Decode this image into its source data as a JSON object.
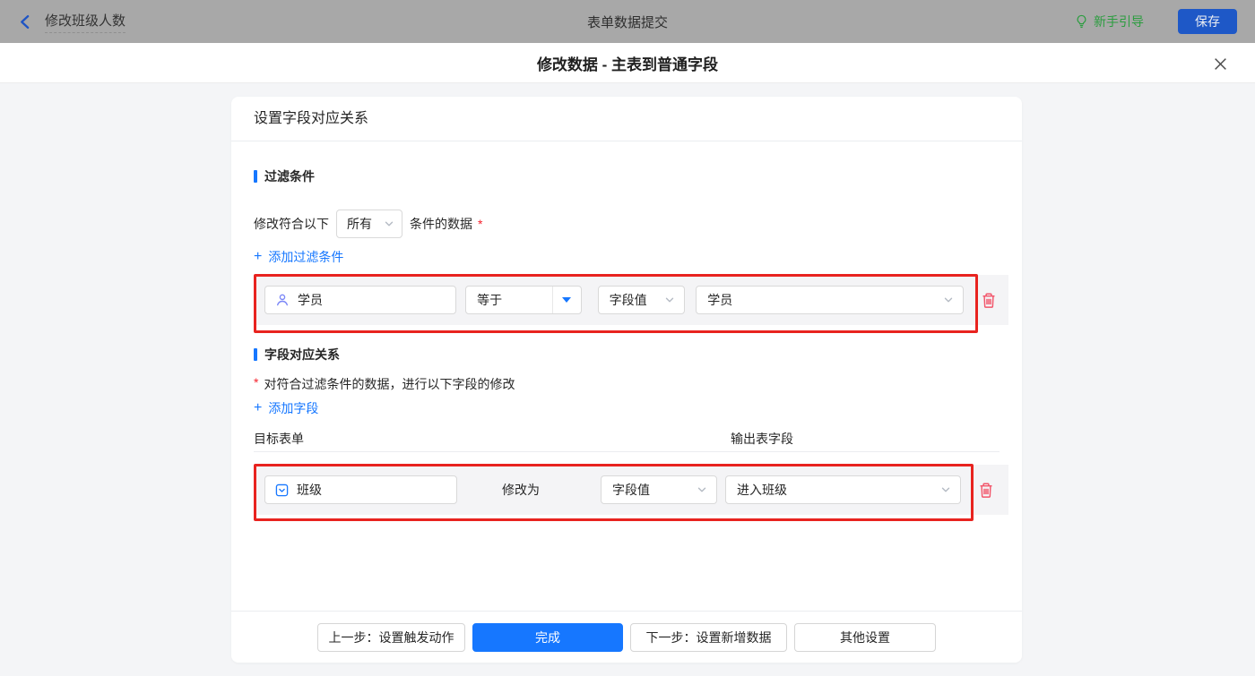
{
  "topbar": {
    "back_title": "修改班级人数",
    "center_title": "表单数据提交",
    "guide_label": "新手引导",
    "save_label": "保存"
  },
  "dialog": {
    "title": "修改数据 - 主表到普通字段"
  },
  "card": {
    "header": "设置字段对应关系",
    "filter_section": {
      "title": "过滤条件",
      "sentence_prefix": "修改符合以下",
      "match_select_value": "所有",
      "sentence_suffix": "条件的数据",
      "required_mark": "*",
      "add_plus": "+",
      "add_label": "添加过滤条件",
      "row": {
        "field": "学员",
        "operator": "等于",
        "value_type": "字段值",
        "value": "学员"
      }
    },
    "mapping_section": {
      "title": "字段对应关系",
      "required_mark": "*",
      "description": "对符合过滤条件的数据，进行以下字段的修改",
      "add_plus": "+",
      "add_label": "添加字段",
      "col_target": "目标表单",
      "col_output": "输出表字段",
      "row": {
        "field": "班级",
        "action_label": "修改为",
        "value_type": "字段值",
        "value": "进入班级"
      }
    },
    "footer": {
      "prev_label": "上一步：设置触发动作",
      "done_label": "完成",
      "next_label": "下一步：设置新增数据",
      "other_label": "其他设置"
    }
  },
  "icons": {
    "back": "chevron-left",
    "guide": "lightbulb",
    "close": "x-mark",
    "filter_field": "person",
    "mapping_field": "select-box",
    "select_arrow": "chevron-down",
    "operator_arrow": "caret-down-filled",
    "delete": "trash"
  },
  "colors": {
    "accent_blue": "#1677ff",
    "highlight_red": "#e8231f",
    "delete_red": "#f2556a",
    "guide_green": "#2b9d3f",
    "topbar_bg": "#a8a8a8",
    "page_bg": "#f4f5f7"
  }
}
